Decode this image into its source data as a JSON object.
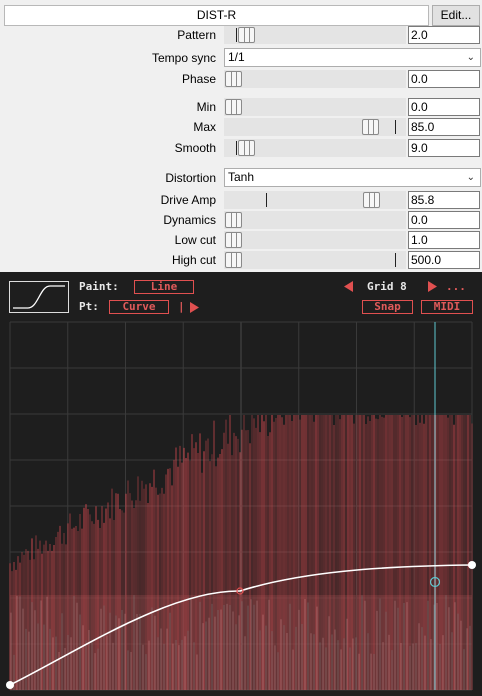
{
  "plugin": {
    "title": "DIST-R",
    "edit_label": "Edit..."
  },
  "params": {
    "pattern": {
      "label": "Pattern",
      "value": "2.0",
      "level": 0.0
    },
    "tempo_sync": {
      "label": "Tempo sync",
      "value": "1/1"
    },
    "phase": {
      "label": "Phase",
      "value": "0.0",
      "level": 0.0
    },
    "min": {
      "label": "Min",
      "value": "0.0",
      "level": 0.0
    },
    "max": {
      "label": "Max",
      "value": "85.0",
      "level": 0.85
    },
    "smooth": {
      "label": "Smooth",
      "value": "9.0",
      "level": 0.09
    },
    "distortion": {
      "label": "Distortion",
      "value": "Tanh"
    },
    "drive_amp": {
      "label": "Drive Amp",
      "value": "85.8",
      "level": 0.858
    },
    "dynamics": {
      "label": "Dynamics",
      "value": "0.0",
      "level": 0.0
    },
    "low_cut": {
      "label": "Low cut",
      "value": "1.0",
      "level": 0.0
    },
    "high_cut": {
      "label": "High cut",
      "value": "500.0",
      "level": 0.0
    }
  },
  "editor": {
    "paint_label": "Paint:",
    "paint_value": "Line",
    "pt_label": "Pt:",
    "pt_value": "Curve",
    "separator": "|",
    "grid_label": "Grid 8",
    "more_label": "...",
    "snap_label": "Snap",
    "midi_label": "MIDI",
    "colors": {
      "accent": "#e05050",
      "background": "#1e1e1e",
      "grid": "#3a3a3a",
      "playhead": "#5ec8d0",
      "curve": "#ffffff"
    },
    "icons": {
      "left": "triangle-left-icon",
      "right": "triangle-right-icon",
      "play": "play-icon"
    }
  }
}
